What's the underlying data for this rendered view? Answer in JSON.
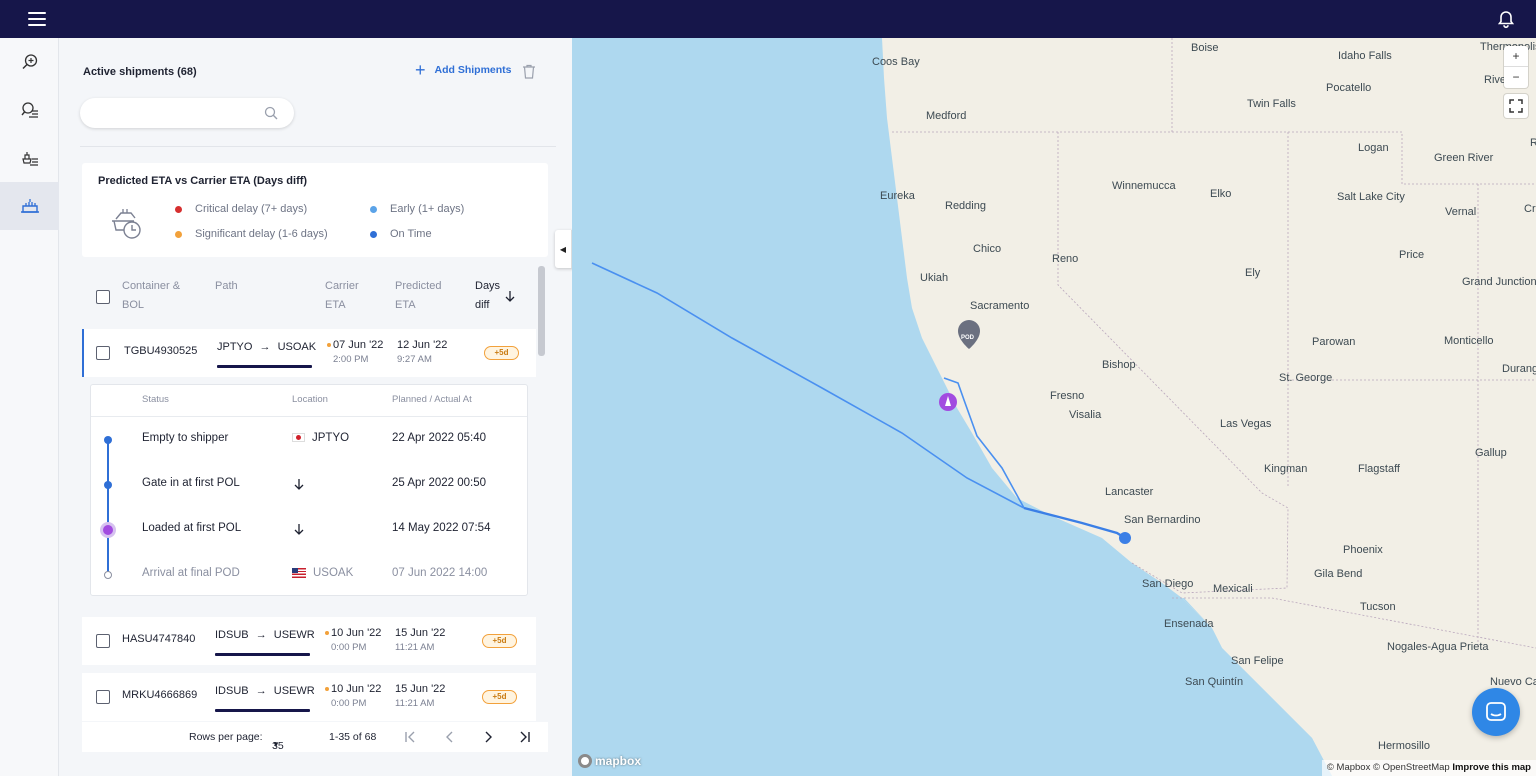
{
  "panel": {
    "title": "Active shipments (68)",
    "add_label": "Add Shipments",
    "search_placeholder": ""
  },
  "legend": {
    "title": "Predicted ETA vs Carrier ETA (Days diff)",
    "items": [
      {
        "label": "Critical delay (7+ days)",
        "color": "#d62f2f"
      },
      {
        "label": "Significant delay (1-6 days)",
        "color": "#f2a13b"
      },
      {
        "label": "Early (1+ days)",
        "color": "#5ba3e8"
      },
      {
        "label": "On Time",
        "color": "#2f6fd6"
      }
    ]
  },
  "table": {
    "headers": {
      "container_1": "Container &",
      "container_2": "BOL",
      "path": "Path",
      "carrier_1": "Carrier",
      "carrier_2": "ETA",
      "predicted_1": "Predicted",
      "predicted_2": "ETA",
      "days_1": "Days",
      "days_2": "diff"
    },
    "rows": [
      {
        "container": "TGBU4930525",
        "from": "JPTYO",
        "to": "USOAK",
        "carrier_date": "07 Jun '22",
        "carrier_time": "2:00 PM",
        "pred_date": "12 Jun '22",
        "pred_time": "9:27 AM",
        "diff": "+5d"
      },
      {
        "container": "HASU4747840",
        "from": "IDSUB",
        "to": "USEWR",
        "carrier_date": "10 Jun '22",
        "carrier_time": "0:00 PM",
        "pred_date": "15 Jun '22",
        "pred_time": "11:21 AM",
        "diff": "+5d"
      },
      {
        "container": "MRKU4666869",
        "from": "IDSUB",
        "to": "USEWR",
        "carrier_date": "10 Jun '22",
        "carrier_time": "0:00 PM",
        "pred_date": "15 Jun '22",
        "pred_time": "11:21 AM",
        "diff": "+5d"
      }
    ],
    "arrow": "→"
  },
  "detail": {
    "headers": {
      "status": "Status",
      "location": "Location",
      "planned": "Planned / Actual At"
    },
    "events": [
      {
        "status": "Empty to shipper",
        "location": "JPTYO",
        "date": "22 Apr 2022 05:40"
      },
      {
        "status": "Gate in at first POL",
        "location": "",
        "date": "25 Apr 2022 00:50"
      },
      {
        "status": "Loaded at first POL",
        "location": "",
        "date": "14 May 2022 07:54"
      },
      {
        "status": "Arrival at final POD",
        "location": "USOAK",
        "date": "07 Jun 2022 14:00"
      }
    ]
  },
  "pagination": {
    "rows_label": "Rows per page:",
    "rows_value": "35",
    "range": "1-35 of 68"
  },
  "map": {
    "cities": [
      "Boise",
      "Idaho Falls",
      "Coos Bay",
      "Pocatello",
      "Twin Falls",
      "Medford",
      "Logan",
      "Green River",
      "Eureka",
      "Winnemucca",
      "Elko",
      "Salt Lake City",
      "Vernal",
      "Redding",
      "Chico",
      "Reno",
      "Price",
      "Ukiah",
      "Ely",
      "Grand Junction",
      "Sacramento",
      "Parowan",
      "Monticello",
      "Bishop",
      "St. George",
      "Fresno",
      "Visalia",
      "Las Vegas",
      "Kingman",
      "Flagstaff",
      "Gallup",
      "Lancaster",
      "San Bernardino",
      "Phoenix",
      "Gila Bend",
      "San Diego",
      "Mexicali",
      "Ensenada",
      "Tucson",
      "Nogales-Agua Prieta",
      "San Felipe",
      "San Quintín",
      "Hermosillo",
      "Thermopolis",
      "Riverton",
      "Durango",
      "Nuevo Casas Grandes",
      "Cr",
      "R"
    ],
    "pod_label": "POD",
    "zoom_in": "+",
    "zoom_out": "−",
    "logo": "mapbox",
    "attribution": "© Mapbox © OpenStreetMap",
    "improve": "Improve this map"
  }
}
